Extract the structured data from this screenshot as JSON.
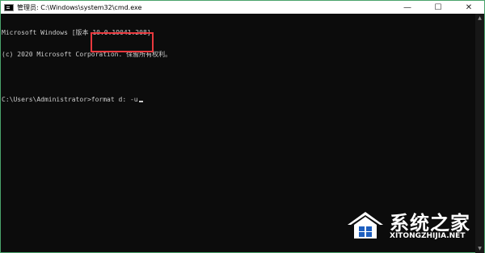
{
  "window": {
    "title": "管理员: C:\\Windows\\system32\\cmd.exe",
    "minimize_glyph": "—",
    "maximize_glyph": "☐",
    "close_glyph": "✕"
  },
  "console": {
    "lines": [
      "Microsoft Windows [版本 10.0.19041.208]",
      "(c) 2020 Microsoft Corporation. 保留所有权利。"
    ],
    "prompt": "C:\\Users\\Administrator>",
    "command": "format d: -u"
  },
  "watermark": {
    "title": "系统之家",
    "subtitle": "XITONGZHIJIA.NET"
  },
  "colors": {
    "console_bg": "#0c0c0c",
    "console_text": "#cccccc",
    "highlight_border": "#e8383d",
    "window_border": "#4aa36b"
  },
  "icons": {
    "app": "cmd-icon",
    "scroll_up": "scroll-up-arrow-icon",
    "scroll_down": "scroll-down-arrow-icon",
    "watermark_logo": "house-logo-icon"
  }
}
